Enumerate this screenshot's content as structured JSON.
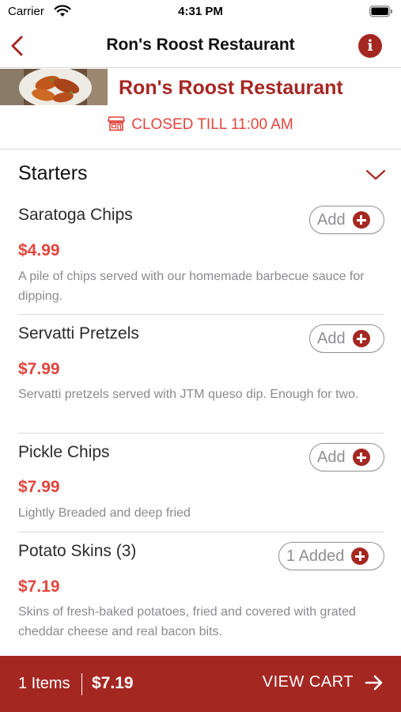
{
  "status_bar": {
    "carrier": "Carrier",
    "time": "4:31 PM"
  },
  "nav": {
    "title": "Ron's Roost Restaurant",
    "back_icon": "chevron-left-icon",
    "info_icon": "info-icon"
  },
  "restaurant": {
    "name": "Ron's Roost Restaurant",
    "status": "CLOSED TILL 11:00 AM",
    "status_icon": "store-icon"
  },
  "section": {
    "title": "Starters",
    "expanded": true
  },
  "items": [
    {
      "name": "Saratoga Chips",
      "price": "$4.99",
      "description": "A pile of chips served with our homemade barbecue sauce for dipping.",
      "button": "Add"
    },
    {
      "name": "Servatti Pretzels",
      "price": "$7.99",
      "description": "Servatti pretzels served with JTM queso dip. Enough for two.",
      "button": "Add"
    },
    {
      "name": "Pickle Chips",
      "price": "$7.99",
      "description": "Lightly Breaded and deep fried",
      "button": "Add"
    },
    {
      "name": "Potato Skins (3)",
      "price": "$7.19",
      "description": "Skins of fresh-baked potatoes, fried and covered with grated cheddar cheese and real bacon bits.",
      "button": "1 Added"
    }
  ],
  "cart": {
    "count": "1 Items",
    "total": "$7.19",
    "view_label": "VIEW CART"
  },
  "colors": {
    "brand": "#a52722",
    "price": "#e2453d",
    "muted": "#8a8a8e"
  }
}
